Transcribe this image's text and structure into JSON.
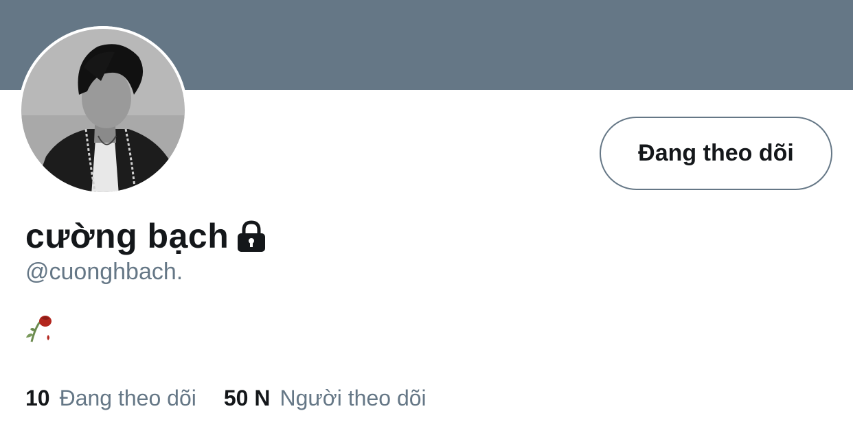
{
  "profile": {
    "display_name": "cường bạch",
    "handle": "@cuonghbach.",
    "bio_icon": "wilted-rose-icon",
    "protected_icon": "lock-icon",
    "banner_color": "#657786"
  },
  "actions": {
    "follow_button_label": "Đang theo dõi"
  },
  "stats": {
    "following_count": "10",
    "following_label": "Đang theo dõi",
    "followers_count": "50 N",
    "followers_label": "Người theo dõi"
  }
}
